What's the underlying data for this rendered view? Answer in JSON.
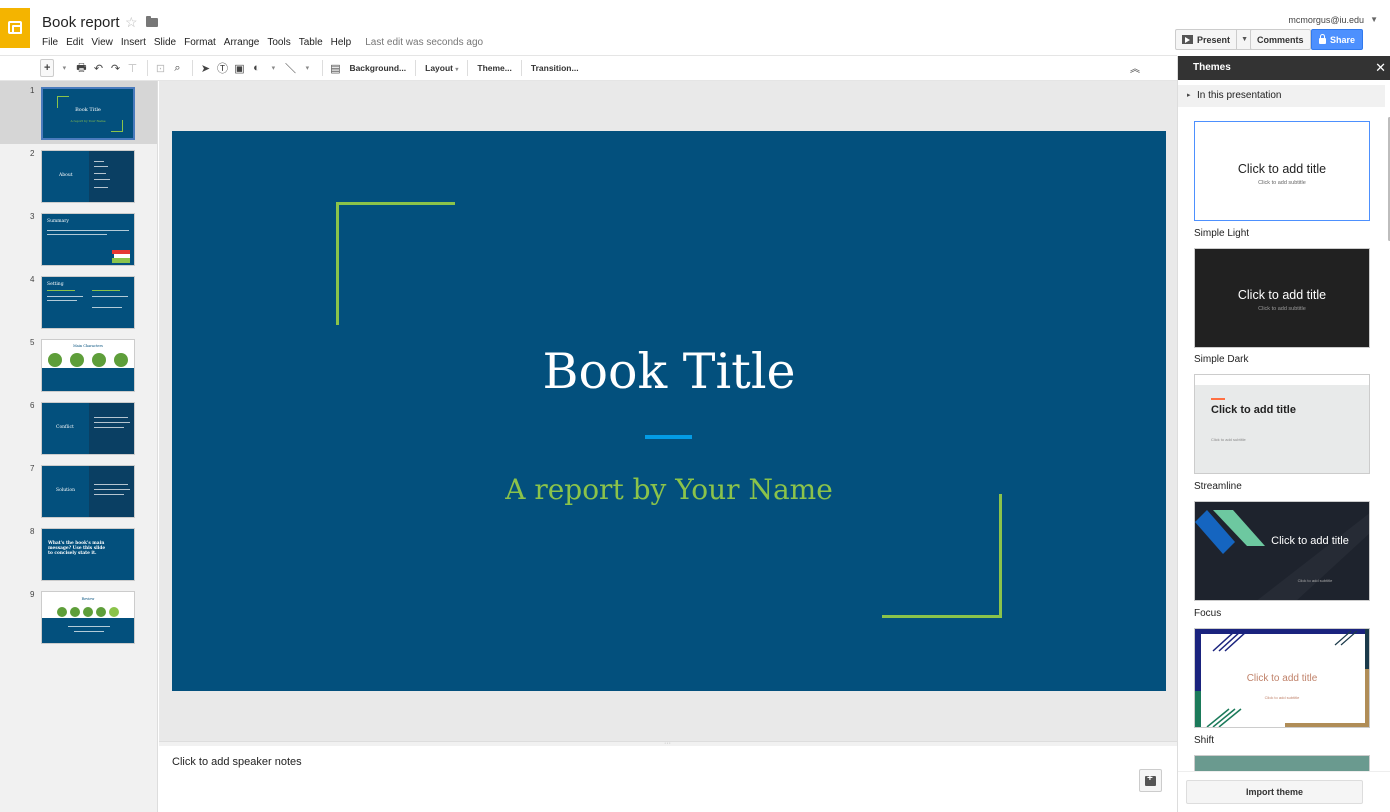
{
  "header": {
    "title": "Book report",
    "user": "mcmorgus@iu.edu",
    "last_edit": "Last edit was seconds ago",
    "menus": [
      "File",
      "Edit",
      "View",
      "Insert",
      "Slide",
      "Format",
      "Arrange",
      "Tools",
      "Table",
      "Help"
    ],
    "present_label": "Present",
    "comments_label": "Comments",
    "share_label": "Share"
  },
  "toolbar": {
    "background_label": "Background...",
    "layout_label": "Layout",
    "theme_label": "Theme...",
    "transition_label": "Transition..."
  },
  "filmstrip": {
    "slides": [
      {
        "number": "1",
        "title": "Book Title",
        "subtitle": "A report by Your Name"
      },
      {
        "number": "2",
        "title": "About"
      },
      {
        "number": "3",
        "title": "Summary"
      },
      {
        "number": "4",
        "title": "Setting"
      },
      {
        "number": "5",
        "title": "Main Characters"
      },
      {
        "number": "6",
        "title": "Conflict"
      },
      {
        "number": "7",
        "title": "Solution"
      },
      {
        "number": "8",
        "title": "What's the book's main message? Use this slide to concisely state it."
      },
      {
        "number": "9",
        "title": "Review"
      }
    ]
  },
  "slide": {
    "title": "Book Title",
    "subtitle": "A report by Your Name"
  },
  "notes": {
    "placeholder": "Click to add speaker notes"
  },
  "themes": {
    "panel_title": "Themes",
    "section_label": "In this presentation",
    "card_title": "Click to add title",
    "card_subtitle": "Click to add subtitle",
    "items": [
      {
        "name": "Simple Light"
      },
      {
        "name": "Simple Dark"
      },
      {
        "name": "Streamline"
      },
      {
        "name": "Focus"
      },
      {
        "name": "Shift"
      }
    ],
    "import_label": "Import theme"
  },
  "colors": {
    "slide_bg": "#03507d",
    "accent_green": "#8bc34a",
    "accent_blue": "#039be5",
    "logo_yellow": "#f4b400",
    "share_blue": "#4d90fe"
  }
}
